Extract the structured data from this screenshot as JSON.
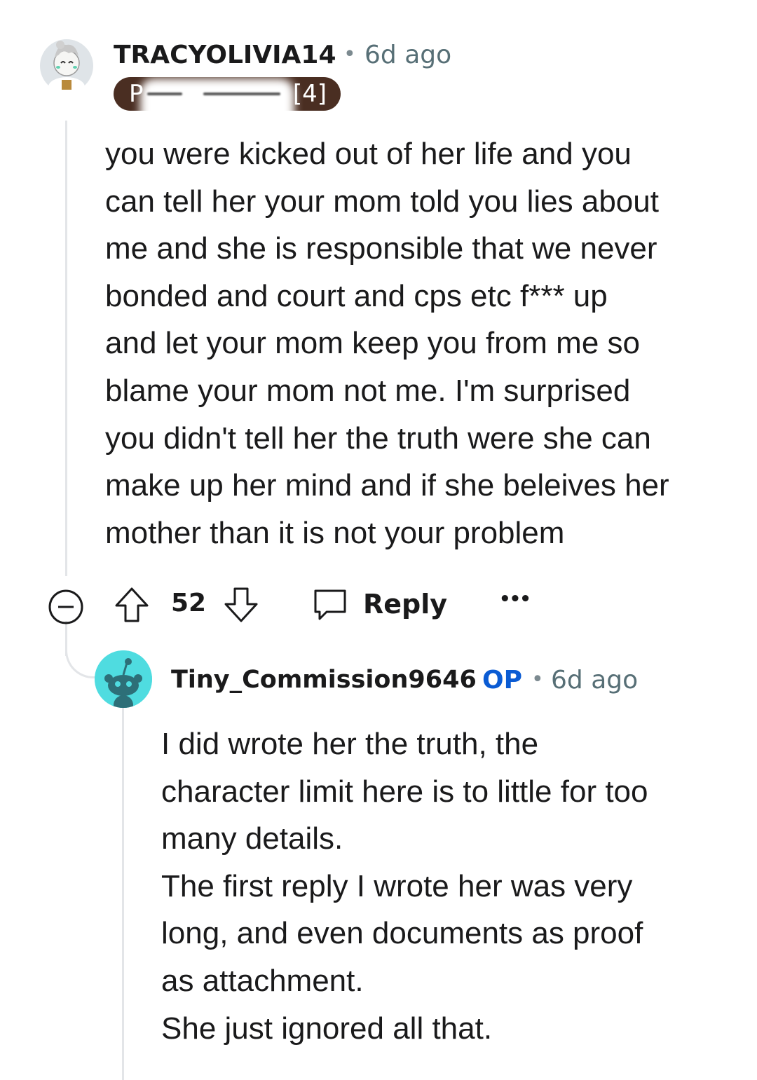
{
  "comment1": {
    "username": "TRACYOLIVIA14",
    "separator": "•",
    "time": "6d ago",
    "flair": {
      "visible_start": "P",
      "visible_end": "[4]"
    },
    "body": "you were kicked out of her life and you\ncan tell her your mom told you lies about\nme and she is responsible that we never\nbonded and court and cps etc f*** up\nand let your mom keep you from me so\nblame your mom not me. I'm surprised\nyou didn't tell her the truth were she can\nmake up her mind and if she beleives her\nmother than it is not your problem",
    "actions": {
      "collapse_icon": "minus-circle-icon",
      "upvote_icon": "arrow-up-icon",
      "score": "52",
      "downvote_icon": "arrow-down-icon",
      "reply_icon": "comment-bubble-icon",
      "reply_label": "Reply",
      "more_icon": "more-dots-icon",
      "more_label": "•••"
    }
  },
  "comment2": {
    "username": "Tiny_Commission9646",
    "op_badge": "OP",
    "separator": "•",
    "time": "6d ago",
    "body": "I did wrote her the truth, the\ncharacter limit here is to little for too\nmany details.\nThe first reply I wrote her was very\nlong, and even documents as proof\nas attachment.\nShe just ignored all that."
  },
  "colors": {
    "flair_bg": "#4a2e22",
    "op_blue": "#0a5bd3",
    "avatar2_bg": "#4fdce0",
    "meta_gray": "#576f76",
    "thread_line": "#e3e5e8"
  }
}
